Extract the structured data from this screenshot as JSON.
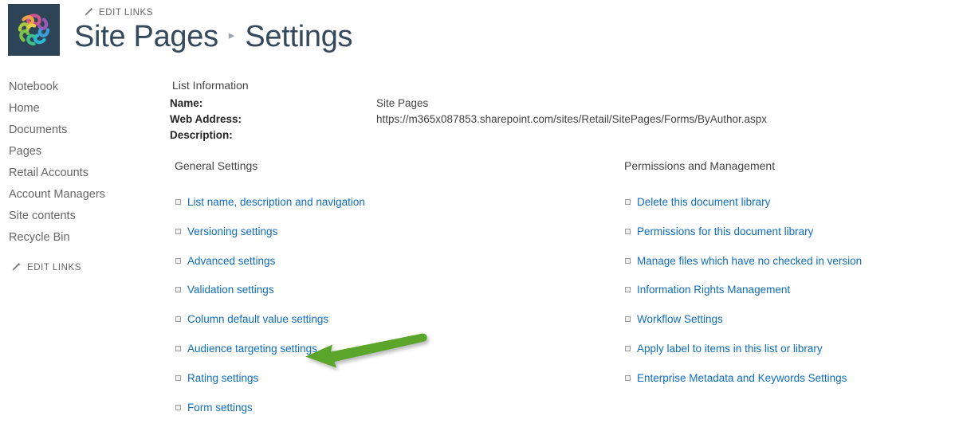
{
  "header": {
    "logo_icon": "site-logo-knot-icon",
    "logo_bg": "#2d4356",
    "edit_links_label": "EDIT LINKS",
    "edit_links_icon": "pencil-icon",
    "breadcrumb": {
      "parent": "Site Pages",
      "separator": "▸",
      "current": "Settings"
    }
  },
  "sidebar": {
    "items": [
      {
        "label": "Notebook"
      },
      {
        "label": "Home"
      },
      {
        "label": "Documents"
      },
      {
        "label": "Pages"
      },
      {
        "label": "Retail Accounts"
      },
      {
        "label": "Account Managers"
      },
      {
        "label": "Site contents"
      },
      {
        "label": "Recycle Bin"
      }
    ],
    "edit_links_label": "EDIT LINKS",
    "edit_links_icon": "pencil-icon"
  },
  "main": {
    "list_information": {
      "heading": "List Information",
      "rows": [
        {
          "label": "Name:",
          "value": "Site Pages"
        },
        {
          "label": "Web Address:",
          "value": "https://m365x087853.sharepoint.com/sites/Retail/SitePages/Forms/ByAuthor.aspx"
        },
        {
          "label": "Description:",
          "value": ""
        }
      ]
    },
    "general_settings": {
      "heading": "General Settings",
      "links": [
        {
          "label": "List name, description and navigation"
        },
        {
          "label": "Versioning settings"
        },
        {
          "label": "Advanced settings"
        },
        {
          "label": "Validation settings"
        },
        {
          "label": "Column default value settings"
        },
        {
          "label": "Audience targeting settings"
        },
        {
          "label": "Rating settings"
        },
        {
          "label": "Form settings"
        }
      ]
    },
    "permissions_and_management": {
      "heading": "Permissions and Management",
      "links": [
        {
          "label": "Delete this document library"
        },
        {
          "label": "Permissions for this document library"
        },
        {
          "label": "Manage files which have no checked in version"
        },
        {
          "label": "Information Rights Management"
        },
        {
          "label": "Workflow Settings"
        },
        {
          "label": "Apply label to items in this list or library"
        },
        {
          "label": "Enterprise Metadata and Keywords Settings"
        }
      ]
    }
  },
  "annotation": {
    "arrow_icon": "green-arrow-left-icon",
    "arrow_color": "#5aa52b",
    "points_at": "Audience targeting settings"
  },
  "colors": {
    "link_blue": "#0f6cbd",
    "title_slate": "#35495c",
    "sidebar_gray": "#666666",
    "annotation_green": "#5aa52b",
    "logo_background": "#2d4356"
  }
}
